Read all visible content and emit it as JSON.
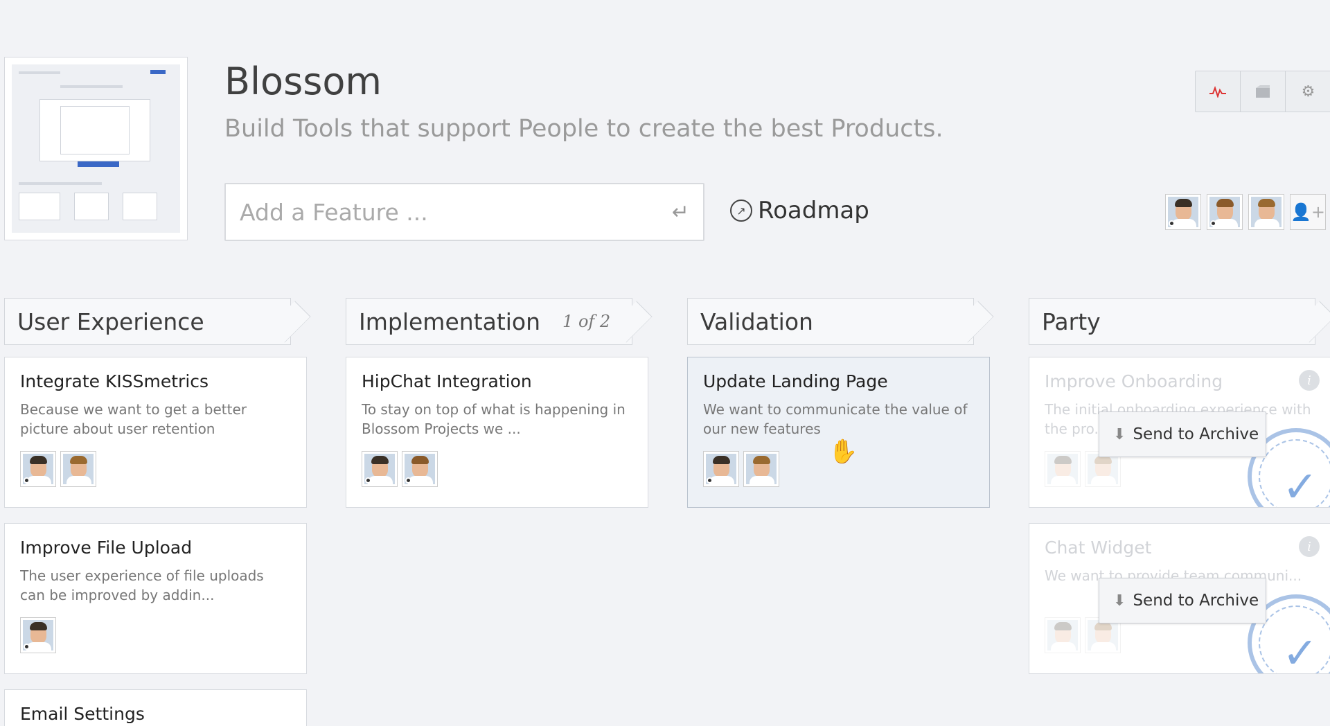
{
  "project": {
    "title": "Blossom",
    "subtitle": "Build Tools that support People to create the best Products."
  },
  "add_feature": {
    "placeholder": "Add a Feature ..."
  },
  "roadmap": {
    "label": "Roadmap"
  },
  "toolbar": {
    "icons": [
      "activity-icon",
      "archive-box-icon",
      "gear-icon"
    ]
  },
  "columns": [
    {
      "title": "User Experience",
      "count": ""
    },
    {
      "title": "Implementation",
      "count": "1 of 2"
    },
    {
      "title": "Validation",
      "count": ""
    },
    {
      "title": "Party",
      "count": ""
    }
  ],
  "cards": {
    "integrate_kissmetrics": {
      "title": "Integrate KISSmetrics",
      "description": "Because we want to get a better picture about user retention"
    },
    "improve_file_upload": {
      "title": "Improve File Upload",
      "description": "The user experience of file uploads can be improved by addin..."
    },
    "email_settings": {
      "title": "Email Settings"
    },
    "hipchat_integration": {
      "title": "HipChat Integration",
      "description": "To stay on top of what is happening in Blossom Projects we ..."
    },
    "update_landing_page": {
      "title": "Update Landing Page",
      "description": "We want to communicate the value of our new features"
    },
    "improve_onboarding": {
      "title": "Improve Onboarding",
      "description": "The initial onboarding experience with the pro..."
    },
    "chat_widget": {
      "title": "Chat Widget",
      "description": "We want to provide team communi..."
    }
  },
  "archive": {
    "label": "Send to Archive"
  },
  "colors": {
    "background": "#f2f3f6",
    "card_hover": "#edf1f6",
    "stamp": "#8eb0de",
    "activity": "#dd3333"
  }
}
